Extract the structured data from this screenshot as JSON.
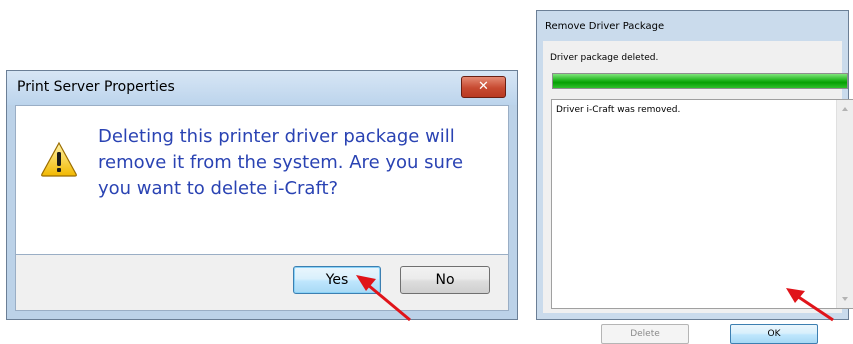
{
  "print_server_dialog": {
    "title": "Print Server Properties",
    "close_label": "✕",
    "message": "Deleting this printer driver package will remove it from the system. Are you sure you want to delete i-Craft?",
    "yes_label": "Yes",
    "no_label": "No"
  },
  "remove_driver_dialog": {
    "title": "Remove Driver Package",
    "status": "Driver package deleted.",
    "progress_fraction": 1.0,
    "log_text": "Driver i-Craft was removed.",
    "delete_label": "Delete",
    "ok_label": "OK"
  },
  "colors": {
    "message_text": "#2a43b3",
    "progress_fill": "#06a003",
    "annotation_arrow": "#e0141a"
  }
}
